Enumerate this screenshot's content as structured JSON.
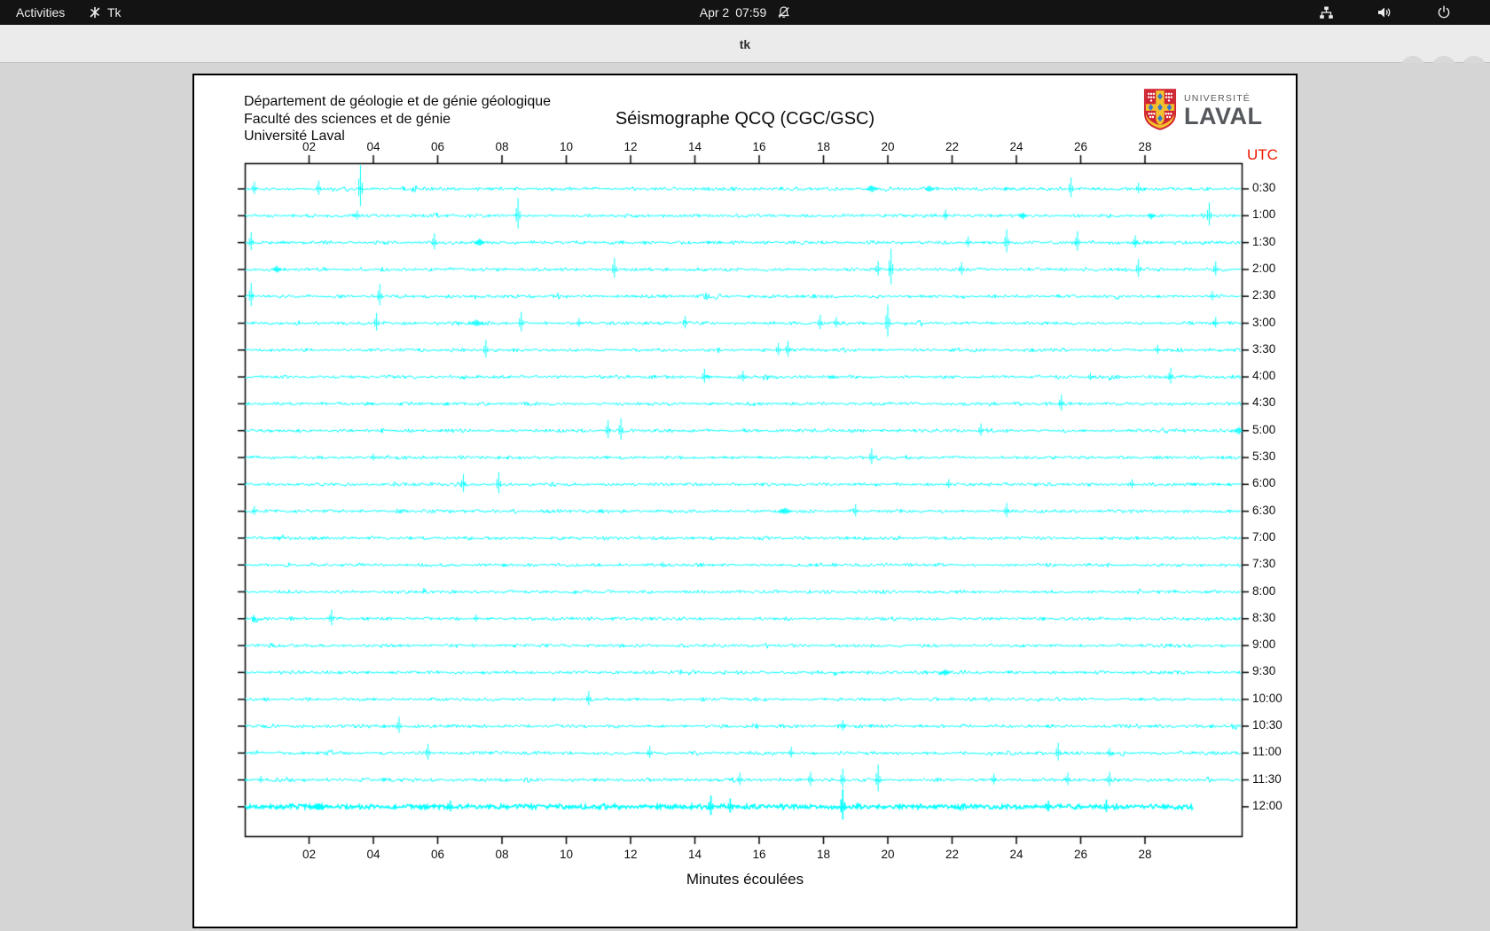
{
  "topbar": {
    "activities": "Activities",
    "app_name": "Tk",
    "clock_date": "Apr 2",
    "clock_time": "07:59"
  },
  "titlebar": {
    "title": "tk"
  },
  "window": {
    "header_lines": [
      "Département de géologie et de génie géologique",
      "Faculté des sciences et de génie",
      "Université Laval"
    ],
    "title": "Séismographe QCQ (CGC/GSC)",
    "logo": {
      "top": "UNIVERSITÉ",
      "bottom": "LAVAL"
    },
    "utc_label": "UTC",
    "x_axis_label": "Minutes écoulées"
  },
  "colors": {
    "trace": "#00ffff",
    "utc_label": "#f01800",
    "axis": "#000000",
    "logo_red": "#cf2433",
    "logo_yellow": "#f3c02f",
    "logo_blue": "#3178d2"
  },
  "chart_data": {
    "type": "seismogram-helicorder",
    "x_unit": "minutes",
    "x_range": [
      0,
      31
    ],
    "minutes_per_row": 30,
    "x_ticks": [
      [
        2,
        "02"
      ],
      [
        4,
        "04"
      ],
      [
        6,
        "06"
      ],
      [
        8,
        "08"
      ],
      [
        10,
        "10"
      ],
      [
        12,
        "12"
      ],
      [
        14,
        "14"
      ],
      [
        16,
        "16"
      ],
      [
        18,
        "18"
      ],
      [
        20,
        "20"
      ],
      [
        22,
        "22"
      ],
      [
        24,
        "24"
      ],
      [
        26,
        "26"
      ],
      [
        28,
        "28"
      ]
    ],
    "rows": [
      {
        "label": "0:30",
        "end": 31,
        "spikes": [
          [
            0.3,
            14
          ],
          [
            2.3,
            16
          ],
          [
            3.6,
            46
          ],
          [
            19.5,
            9,
            6
          ],
          [
            21.3,
            9,
            5
          ],
          [
            25.7,
            22
          ],
          [
            27.8,
            12
          ]
        ]
      },
      {
        "label": "1:00",
        "end": 31,
        "spikes": [
          [
            3.5,
            10
          ],
          [
            8.5,
            34
          ],
          [
            21.8,
            12
          ],
          [
            24.2,
            8,
            5
          ],
          [
            28.2,
            9,
            4
          ],
          [
            30.0,
            26
          ]
        ]
      },
      {
        "label": "1:30",
        "end": 31,
        "spikes": [
          [
            0.2,
            20
          ],
          [
            5.9,
            18
          ],
          [
            7.3,
            9,
            6
          ],
          [
            22.5,
            12
          ],
          [
            23.7,
            26
          ],
          [
            25.9,
            22
          ],
          [
            27.7,
            14
          ]
        ]
      },
      {
        "label": "2:00",
        "end": 31,
        "spikes": [
          [
            1.0,
            9,
            5
          ],
          [
            11.5,
            22
          ],
          [
            19.7,
            16
          ],
          [
            20.1,
            40
          ],
          [
            22.3,
            14
          ],
          [
            27.8,
            20
          ],
          [
            30.2,
            16
          ]
        ]
      },
      {
        "label": "2:30",
        "end": 31,
        "spikes": [
          [
            0.2,
            26
          ],
          [
            4.2,
            24
          ],
          [
            30.1,
            10
          ]
        ]
      },
      {
        "label": "3:00",
        "end": 31,
        "spikes": [
          [
            4.1,
            20
          ],
          [
            7.2,
            9,
            7
          ],
          [
            8.6,
            22
          ],
          [
            10.4,
            10
          ],
          [
            13.7,
            14
          ],
          [
            17.9,
            16
          ],
          [
            18.4,
            12
          ],
          [
            20.0,
            36
          ],
          [
            30.2,
            12
          ]
        ]
      },
      {
        "label": "3:30",
        "end": 31,
        "spikes": [
          [
            7.5,
            20
          ],
          [
            16.6,
            14
          ],
          [
            16.9,
            18
          ],
          [
            28.4,
            10
          ]
        ]
      },
      {
        "label": "4:00",
        "end": 31,
        "spikes": [
          [
            14.3,
            16
          ],
          [
            15.5,
            12
          ],
          [
            26.3,
            8
          ],
          [
            28.8,
            18
          ]
        ]
      },
      {
        "label": "4:30",
        "end": 31,
        "spikes": [
          [
            25.4,
            18
          ]
        ]
      },
      {
        "label": "5:00",
        "end": 31,
        "spikes": [
          [
            11.3,
            20
          ],
          [
            11.7,
            24
          ],
          [
            22.9,
            14
          ],
          [
            30.9,
            11,
            4
          ]
        ]
      },
      {
        "label": "5:30",
        "end": 31,
        "spikes": [
          [
            4.0,
            8
          ],
          [
            19.5,
            18
          ]
        ]
      },
      {
        "label": "6:00",
        "end": 31,
        "spikes": [
          [
            6.8,
            20
          ],
          [
            7.9,
            24
          ],
          [
            21.9,
            10
          ],
          [
            27.6,
            10
          ]
        ]
      },
      {
        "label": "6:30",
        "end": 31,
        "spikes": [
          [
            0.3,
            10
          ],
          [
            16.8,
            9,
            8
          ],
          [
            19.0,
            14
          ],
          [
            23.7,
            16
          ]
        ]
      },
      {
        "label": "7:00",
        "end": 31,
        "spikes": []
      },
      {
        "label": "7:30",
        "end": 31,
        "spikes": [
          [
            13.0,
            6
          ]
        ]
      },
      {
        "label": "8:00",
        "end": 31,
        "spikes": []
      },
      {
        "label": "8:30",
        "end": 31,
        "spikes": [
          [
            2.7,
            18
          ],
          [
            7.2,
            8
          ]
        ]
      },
      {
        "label": "9:00",
        "end": 31,
        "spikes": []
      },
      {
        "label": "9:30",
        "end": 31,
        "spikes": [
          [
            21.8,
            8,
            6
          ]
        ]
      },
      {
        "label": "10:00",
        "end": 31,
        "spikes": [
          [
            10.7,
            16
          ]
        ]
      },
      {
        "label": "10:30",
        "end": 31,
        "spikes": [
          [
            4.8,
            18
          ],
          [
            18.6,
            12
          ]
        ]
      },
      {
        "label": "11:00",
        "end": 31,
        "spikes": [
          [
            5.7,
            18
          ],
          [
            12.6,
            14
          ],
          [
            17.0,
            12
          ],
          [
            25.3,
            20
          ],
          [
            26.9,
            10
          ]
        ]
      },
      {
        "label": "11:30",
        "end": 31,
        "spikes": [
          [
            0.5,
            8
          ],
          [
            15.4,
            14
          ],
          [
            17.6,
            16
          ],
          [
            18.6,
            22
          ],
          [
            19.7,
            30
          ],
          [
            23.3,
            12
          ],
          [
            25.6,
            14
          ],
          [
            26.9,
            16
          ]
        ]
      },
      {
        "label": "12:00",
        "end": 29.5,
        "bold": true,
        "spikes": [
          [
            2.3,
            10,
            8
          ],
          [
            6.4,
            12
          ],
          [
            14.5,
            22
          ],
          [
            15.1,
            16
          ],
          [
            18.6,
            34
          ],
          [
            25.0,
            12
          ],
          [
            26.8,
            14
          ]
        ]
      }
    ]
  }
}
